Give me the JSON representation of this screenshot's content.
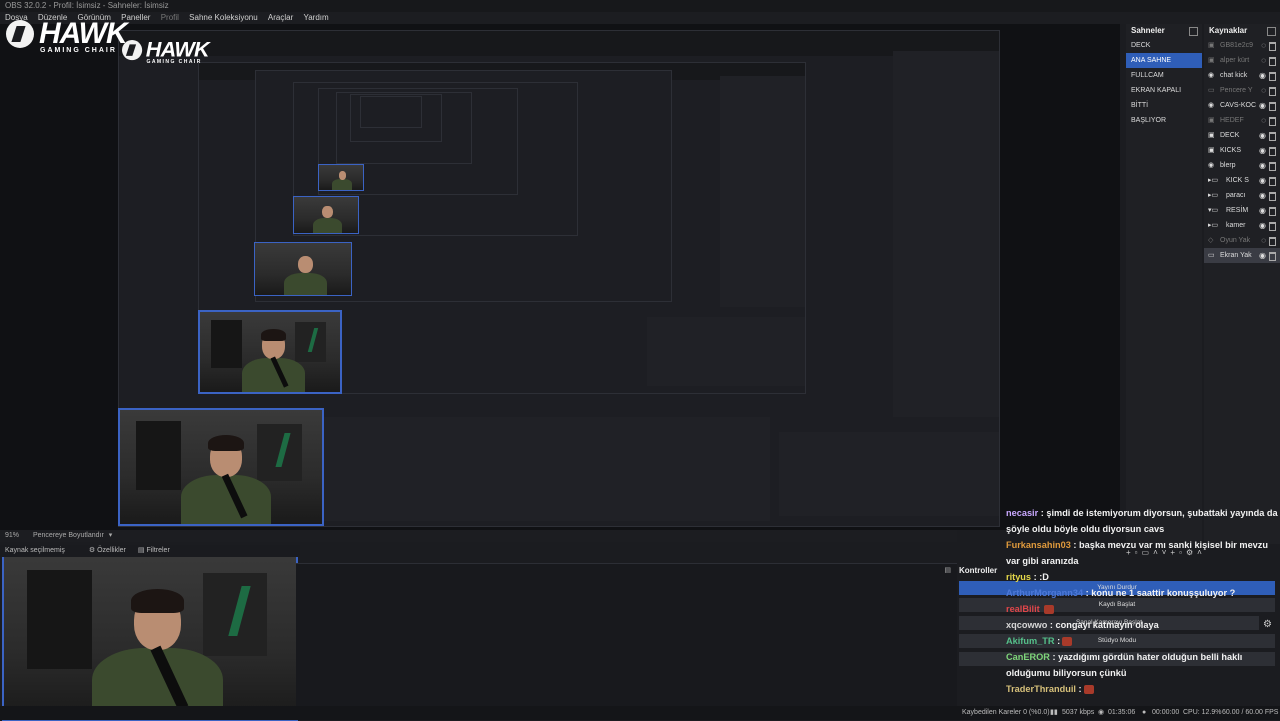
{
  "window": {
    "title": "OBS 32.0.2 - Profil: İsimsiz - Sahneler: İsimsiz"
  },
  "menu": {
    "items": [
      "Dosya",
      "Düzenle",
      "Görünüm",
      "Paneller",
      "Profil",
      "Sahne Koleksiyonu",
      "Araçlar",
      "Yardım"
    ]
  },
  "logo": {
    "brand": "HAWK",
    "tagline": "GAMING CHAIR"
  },
  "scenes": {
    "title": "Sahneler",
    "items": [
      "DECK",
      "ANA SAHNE",
      "FULLCAM",
      "EKRAN KAPALI",
      "BİTTİ",
      "BAŞLIYOR"
    ],
    "selected_index": 1
  },
  "sources": {
    "title": "Kaynaklar",
    "items": [
      {
        "label": "GB81e2c9",
        "icon": "image-icon",
        "dim": true
      },
      {
        "label": "alper kürt",
        "icon": "image-icon",
        "dim": true
      },
      {
        "label": "chat kick",
        "icon": "browser-icon",
        "dim": false
      },
      {
        "label": "Pencere Y",
        "icon": "window-icon",
        "dim": true
      },
      {
        "label": "CAVS-KOC",
        "icon": "browser-icon",
        "dim": false
      },
      {
        "label": "HEDEF",
        "icon": "image-icon",
        "dim": true
      },
      {
        "label": "DECK",
        "icon": "image-icon",
        "dim": false
      },
      {
        "label": "KICKS",
        "icon": "image-icon",
        "dim": false
      },
      {
        "label": "blerp",
        "icon": "browser-icon",
        "dim": false
      },
      {
        "label": "KICK S",
        "icon": "folder-icon",
        "dim": false
      },
      {
        "label": "paracı",
        "icon": "folder-icon",
        "dim": false
      },
      {
        "label": "RESİM",
        "icon": "folder-icon",
        "dim": false
      },
      {
        "label": "kamer",
        "icon": "folder-icon",
        "dim": false
      },
      {
        "label": "Oyun Yak",
        "icon": "game-icon",
        "dim": true
      },
      {
        "label": "Ekran Yak",
        "icon": "monitor-icon",
        "dim": false
      }
    ]
  },
  "source_bar": {
    "zoom": "91%",
    "fit_label": "Pencereye Boyutlandır"
  },
  "source_info": {
    "none_selected": "Kaynak seçilmemiş",
    "properties": "Özellikler",
    "filters": "Filtreler"
  },
  "controls": {
    "title": "Kontroller",
    "buttons": [
      "Yayını Durdur",
      "Kaydı Başlat",
      "Sanal Kamerayı Başlat",
      "Stüdyo Modu"
    ]
  },
  "chat": [
    {
      "user": "necasir",
      "color": "#c9a8ff",
      "text": ": şimdi de istemiyorum diyorsun, şubattaki yayında da şöyle oldu böyle oldu diyorsun cavs",
      "emote": false
    },
    {
      "user": "Furkansahin03",
      "color": "#e09a3c",
      "text": ": başka mevzu var mı sanki kişisel bir mevzu var gibi aranızda",
      "emote": false
    },
    {
      "user": "rityus",
      "color": "#e6d94a",
      "text": ": :D",
      "emote": false
    },
    {
      "user": "ArthurMorgann34",
      "color": "#4d79d8",
      "text": ": konu ne 1 saattir konuşşuluyor ?",
      "emote": false
    },
    {
      "user": "realBilit",
      "color": "#e0464a",
      "text": "",
      "emote": true
    },
    {
      "user": "xqcowwo",
      "color": "#d6d6d6",
      "text": ": congayı katmayın olaya",
      "emote": false
    },
    {
      "user": "Akifum_TR",
      "color": "#55c08a",
      "text": ":",
      "emote": true
    },
    {
      "user": "CanEROR",
      "color": "#7fd67a",
      "text": ": yazdığımı gördün hater olduğun belli haklı olduğumu biliyorsun çünkü",
      "emote": false
    },
    {
      "user": "TraderThranduil",
      "color": "#d6c07a",
      "text": ":",
      "emote": true
    }
  ],
  "status": {
    "dropped": "Kaybedilen Kareler 0 (%0.0)",
    "bitrate": "5037 kbps",
    "live_time": "01:35:06",
    "rec_time": "00:00:00",
    "cpu": "CPU: 12.9%",
    "fps": "60.00 / 60.00 FPS"
  }
}
